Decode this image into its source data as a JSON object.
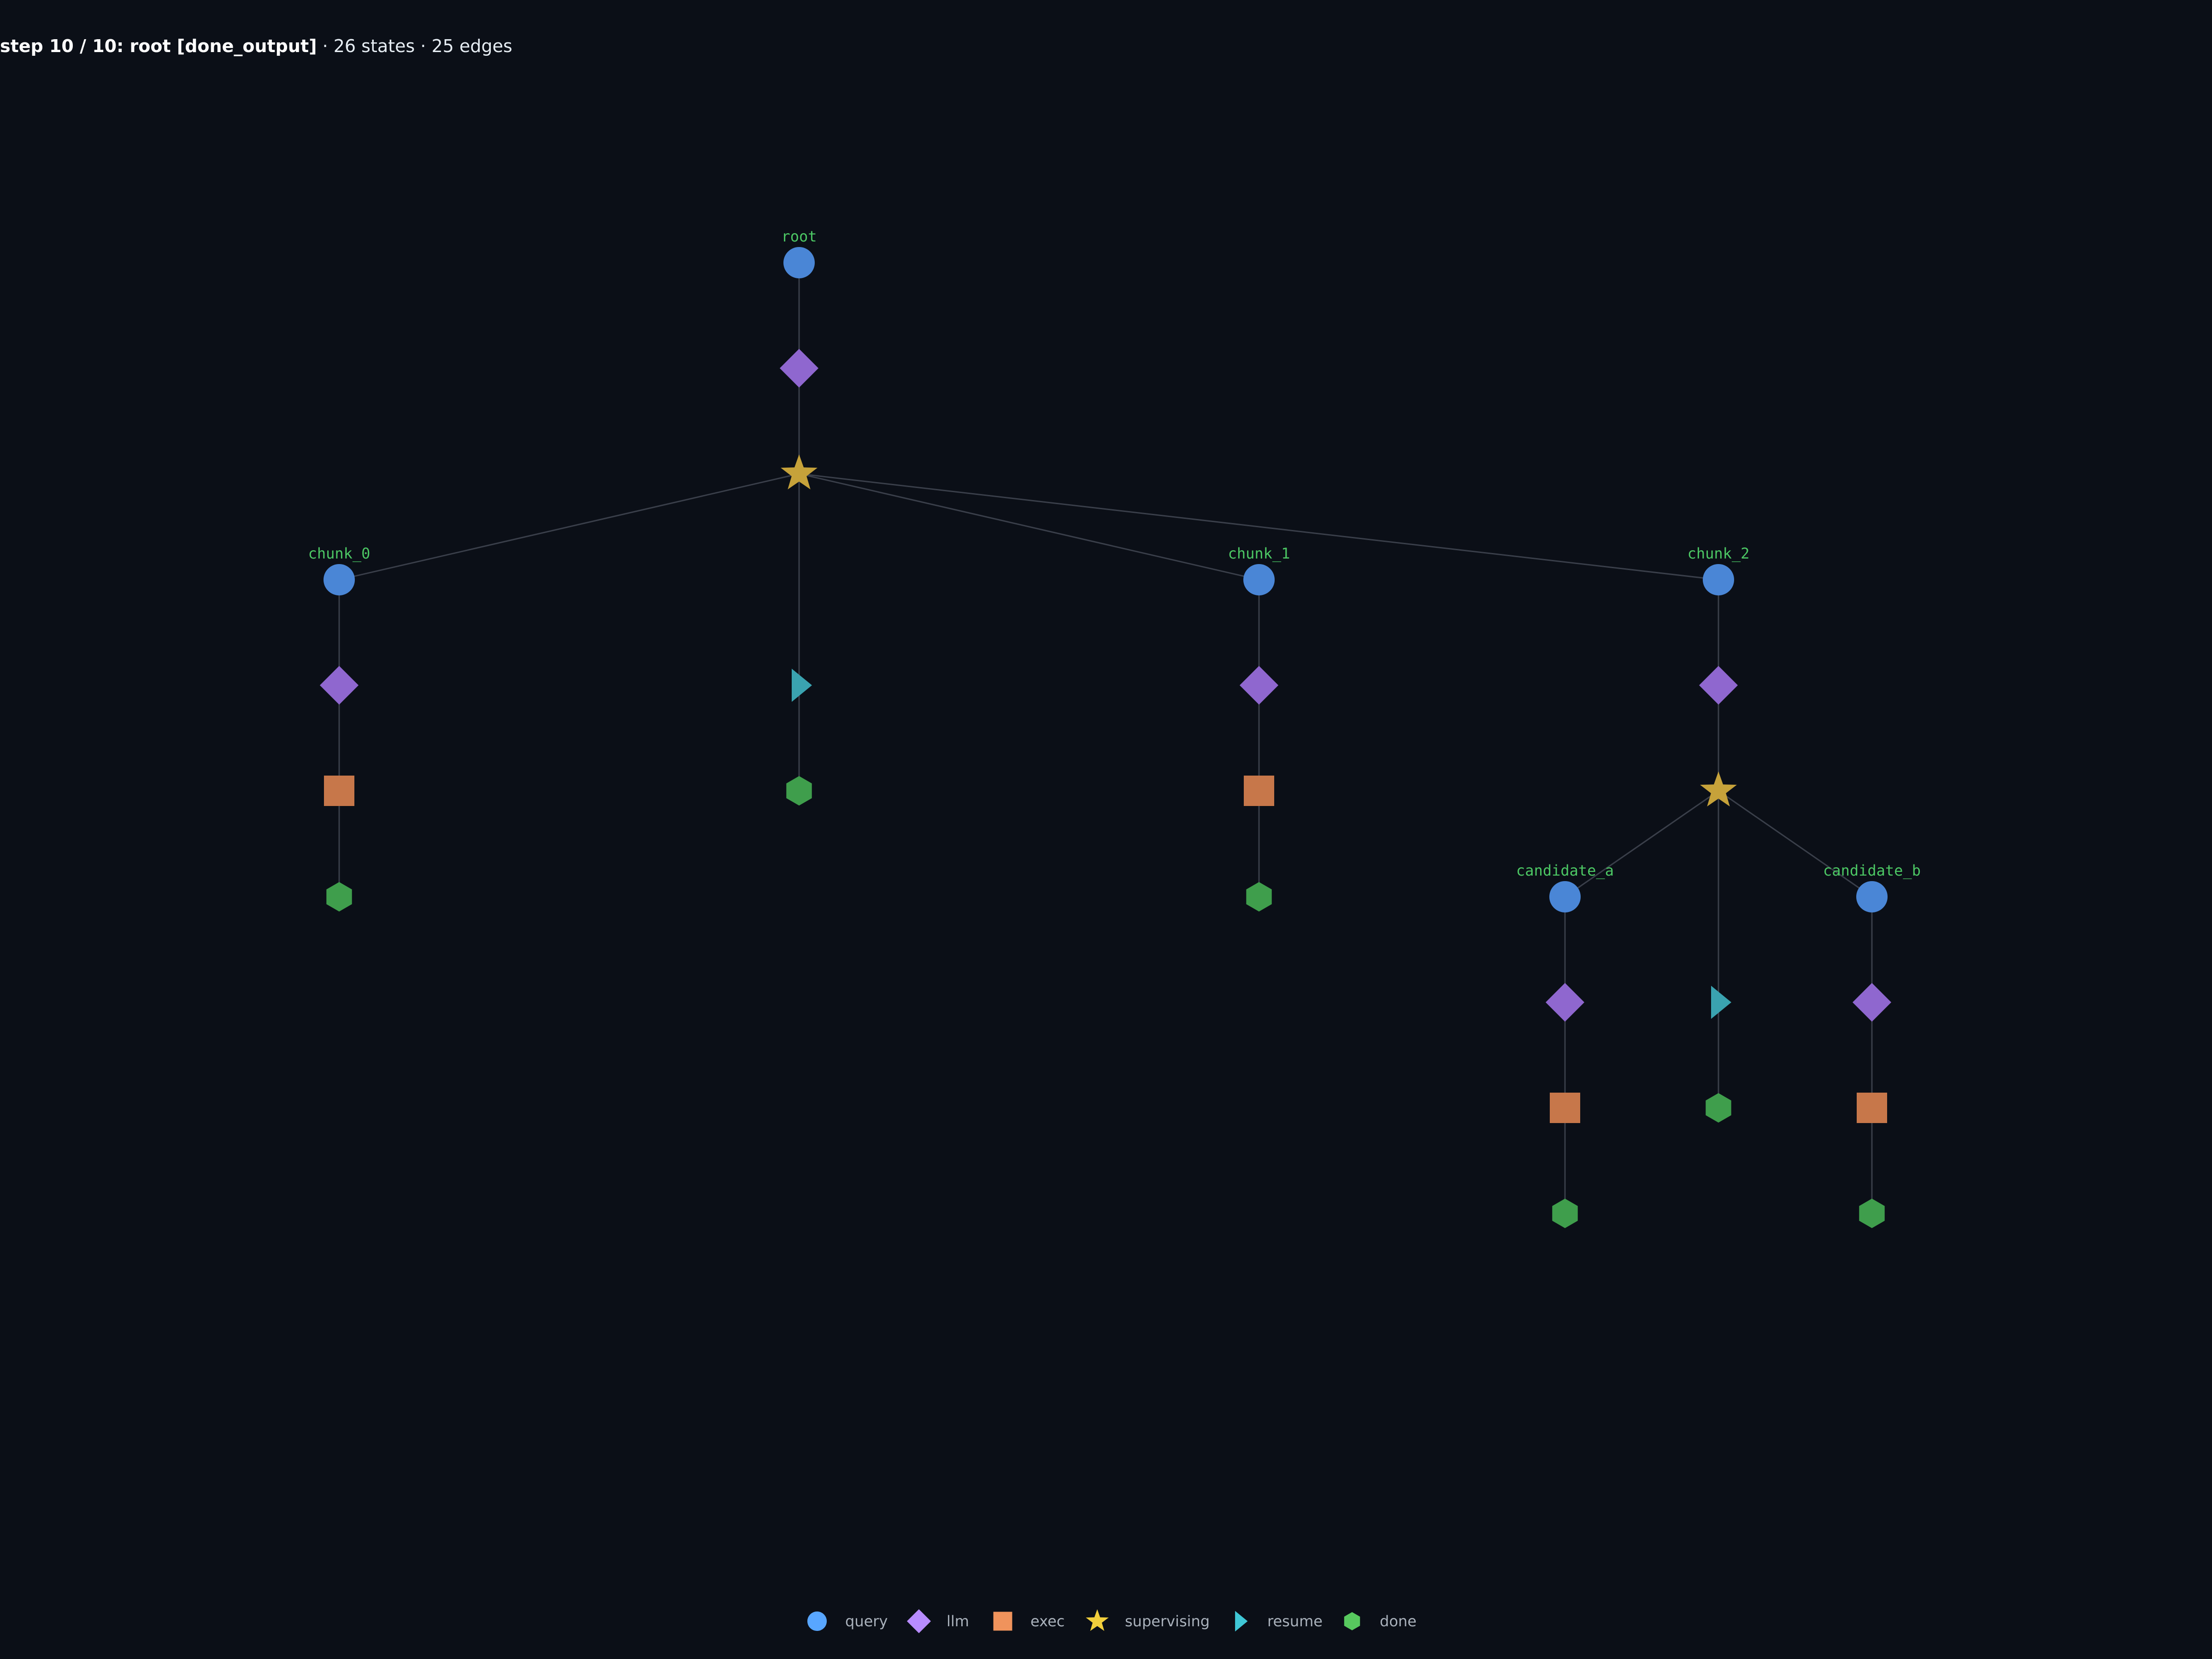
{
  "header": {
    "step_bold": "step 10 / 10: root [done_output]",
    "stats": " · 26 states · 25 edges"
  },
  "colors": {
    "background": "#0b0f17",
    "query": "#4a86d6",
    "llm": "#8f67cf",
    "exec": "#c7774a",
    "supervising": "#c6a23a",
    "resume": "#3aa3b0",
    "done": "#3f9e4c",
    "label": "#4cc764",
    "edge": "#3a3f4a"
  },
  "legend": [
    {
      "kind": "query",
      "label": "query",
      "icon": "circle-icon",
      "color": "#58a6ff"
    },
    {
      "kind": "llm",
      "label": "llm",
      "icon": "diamond-icon",
      "color": "#b88cff"
    },
    {
      "kind": "exec",
      "label": "exec",
      "icon": "square-icon",
      "color": "#f0935c"
    },
    {
      "kind": "supervising",
      "label": "supervising",
      "icon": "star-icon",
      "color": "#f2cf3c"
    },
    {
      "kind": "resume",
      "label": "resume",
      "icon": "triangle-icon",
      "color": "#3fc7d6"
    },
    {
      "kind": "done",
      "label": "done",
      "icon": "hexagon-icon",
      "color": "#57c95e"
    }
  ],
  "nodes": [
    {
      "id": "root_q",
      "kind": "query",
      "label": "root"
    },
    {
      "id": "root_l",
      "kind": "llm",
      "label": ""
    },
    {
      "id": "root_s",
      "kind": "supervising",
      "label": ""
    },
    {
      "id": "root_r",
      "kind": "resume",
      "label": ""
    },
    {
      "id": "root_d",
      "kind": "done",
      "label": ""
    },
    {
      "id": "c0_q",
      "kind": "query",
      "label": "chunk_0"
    },
    {
      "id": "c0_l",
      "kind": "llm",
      "label": ""
    },
    {
      "id": "c0_e",
      "kind": "exec",
      "label": ""
    },
    {
      "id": "c0_d",
      "kind": "done",
      "label": ""
    },
    {
      "id": "c1_q",
      "kind": "query",
      "label": "chunk_1"
    },
    {
      "id": "c1_l",
      "kind": "llm",
      "label": ""
    },
    {
      "id": "c1_e",
      "kind": "exec",
      "label": ""
    },
    {
      "id": "c1_d",
      "kind": "done",
      "label": ""
    },
    {
      "id": "c2_q",
      "kind": "query",
      "label": "chunk_2"
    },
    {
      "id": "c2_l",
      "kind": "llm",
      "label": ""
    },
    {
      "id": "c2_s",
      "kind": "supervising",
      "label": ""
    },
    {
      "id": "c2_r",
      "kind": "resume",
      "label": ""
    },
    {
      "id": "c2_d",
      "kind": "done",
      "label": ""
    },
    {
      "id": "ca_q",
      "kind": "query",
      "label": "candidate_a"
    },
    {
      "id": "ca_l",
      "kind": "llm",
      "label": ""
    },
    {
      "id": "ca_e",
      "kind": "exec",
      "label": ""
    },
    {
      "id": "ca_d",
      "kind": "done",
      "label": ""
    },
    {
      "id": "cb_q",
      "kind": "query",
      "label": "candidate_b"
    },
    {
      "id": "cb_l",
      "kind": "llm",
      "label": ""
    },
    {
      "id": "cb_e",
      "kind": "exec",
      "label": ""
    },
    {
      "id": "cb_d",
      "kind": "done",
      "label": ""
    }
  ],
  "edges": [
    [
      "root_q",
      "root_l"
    ],
    [
      "root_l",
      "root_s"
    ],
    [
      "root_s",
      "c0_q"
    ],
    [
      "root_s",
      "root_r"
    ],
    [
      "root_s",
      "c1_q"
    ],
    [
      "root_s",
      "c2_q"
    ],
    [
      "root_r",
      "root_d"
    ],
    [
      "c0_q",
      "c0_l"
    ],
    [
      "c0_l",
      "c0_e"
    ],
    [
      "c0_e",
      "c0_d"
    ],
    [
      "c1_q",
      "c1_l"
    ],
    [
      "c1_l",
      "c1_e"
    ],
    [
      "c1_e",
      "c1_d"
    ],
    [
      "c2_q",
      "c2_l"
    ],
    [
      "c2_l",
      "c2_s"
    ],
    [
      "c2_s",
      "ca_q"
    ],
    [
      "c2_s",
      "c2_r"
    ],
    [
      "c2_s",
      "cb_q"
    ],
    [
      "c2_r",
      "c2_d"
    ],
    [
      "ca_q",
      "ca_l"
    ],
    [
      "ca_l",
      "ca_e"
    ],
    [
      "ca_e",
      "ca_d"
    ],
    [
      "cb_q",
      "cb_l"
    ],
    [
      "cb_l",
      "cb_e"
    ],
    [
      "cb_e",
      "cb_d"
    ]
  ]
}
